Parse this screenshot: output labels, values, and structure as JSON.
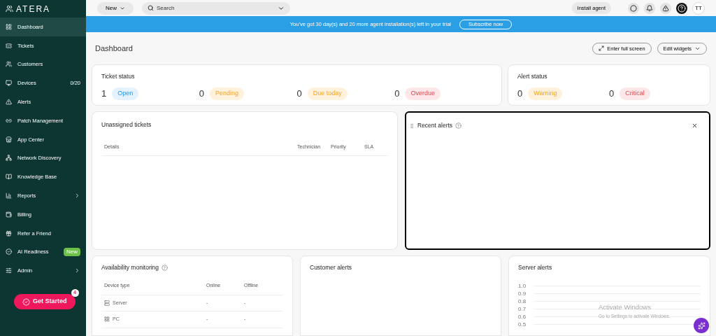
{
  "sidebar": {
    "logo": "ATERA",
    "items": [
      {
        "label": "Dashboard",
        "selected": true,
        "submenu": false
      },
      {
        "label": "Tickets",
        "selected": false,
        "submenu": false
      },
      {
        "label": "Customers",
        "selected": false,
        "submenu": false
      },
      {
        "label": "Devices",
        "selected": false,
        "submenu": false,
        "count": "0/20"
      },
      {
        "label": "Alerts",
        "selected": false,
        "submenu": false
      },
      {
        "label": "Patch Management",
        "selected": false,
        "submenu": false
      },
      {
        "label": "App Center",
        "selected": false,
        "submenu": false
      },
      {
        "label": "Network Discovery",
        "selected": false,
        "submenu": false
      },
      {
        "label": "Knowledge Base",
        "selected": false,
        "submenu": false
      },
      {
        "label": "Reports",
        "selected": false,
        "submenu": true
      },
      {
        "label": "Billing",
        "selected": false,
        "submenu": false
      },
      {
        "label": "Refer a Friend",
        "selected": false,
        "submenu": false
      },
      {
        "label": "AI Readiness",
        "selected": false,
        "submenu": false,
        "badge": "New"
      },
      {
        "label": "Admin",
        "selected": false,
        "submenu": true
      }
    ],
    "get_started": {
      "label": "Get Started",
      "count": "4"
    }
  },
  "topbar": {
    "new_button": "New",
    "search": {
      "placeholder": "Search"
    },
    "install_button": "Install agent",
    "avatar": "TT"
  },
  "banner": {
    "text": "You’ve got 30 day(s) and 20 more agent installation(s) left in your trial",
    "button": "Subscribe now"
  },
  "page": {
    "title": "Dashboard",
    "buttons": [
      "Enter full screen",
      "Edit widgets"
    ]
  },
  "ticket_status": {
    "title": "Ticket status",
    "items": [
      {
        "count": "1",
        "label": "Open",
        "color": "#e3f2fd"
      },
      {
        "count": "0",
        "label": "Pending",
        "color": "#fff1dc"
      },
      {
        "count": "0",
        "label": "Due today",
        "color": "#fff1dc"
      },
      {
        "count": "0",
        "label": "Overdue",
        "color": "#fde7e9"
      }
    ]
  },
  "alert_status": {
    "title": "Alert status",
    "items": [
      {
        "count": "0",
        "label": "Warning",
        "color": "#fff1dc"
      },
      {
        "count": "0",
        "label": "Critical",
        "color": "#fde7e9"
      }
    ]
  },
  "unassigned_tickets": {
    "title": "Unassigned tickets",
    "columns": [
      "Details",
      "Technician",
      "Priority",
      "SLA"
    ]
  },
  "recent_alerts": {
    "title": "Recent alerts",
    "selected": true
  },
  "availability": {
    "title": "Availability monitoring",
    "columns": [
      "Device type",
      "Online",
      "Offline"
    ],
    "rows": [
      {
        "kind": "server",
        "name": "Server",
        "online": "-",
        "offline": "-"
      },
      {
        "kind": "pc",
        "name": "PC",
        "online": "-",
        "offline": "-"
      }
    ]
  },
  "customer_alerts": {
    "title": "Customer alerts"
  },
  "server_alerts": {
    "title": "Server alerts",
    "axis_labels": [
      "1.0",
      "0.9",
      "0.8",
      "0.7",
      "0.6",
      "0.5"
    ]
  },
  "os_notice": {
    "title": "Activate Windows",
    "text": "Go to Settings to activate Windows."
  }
}
